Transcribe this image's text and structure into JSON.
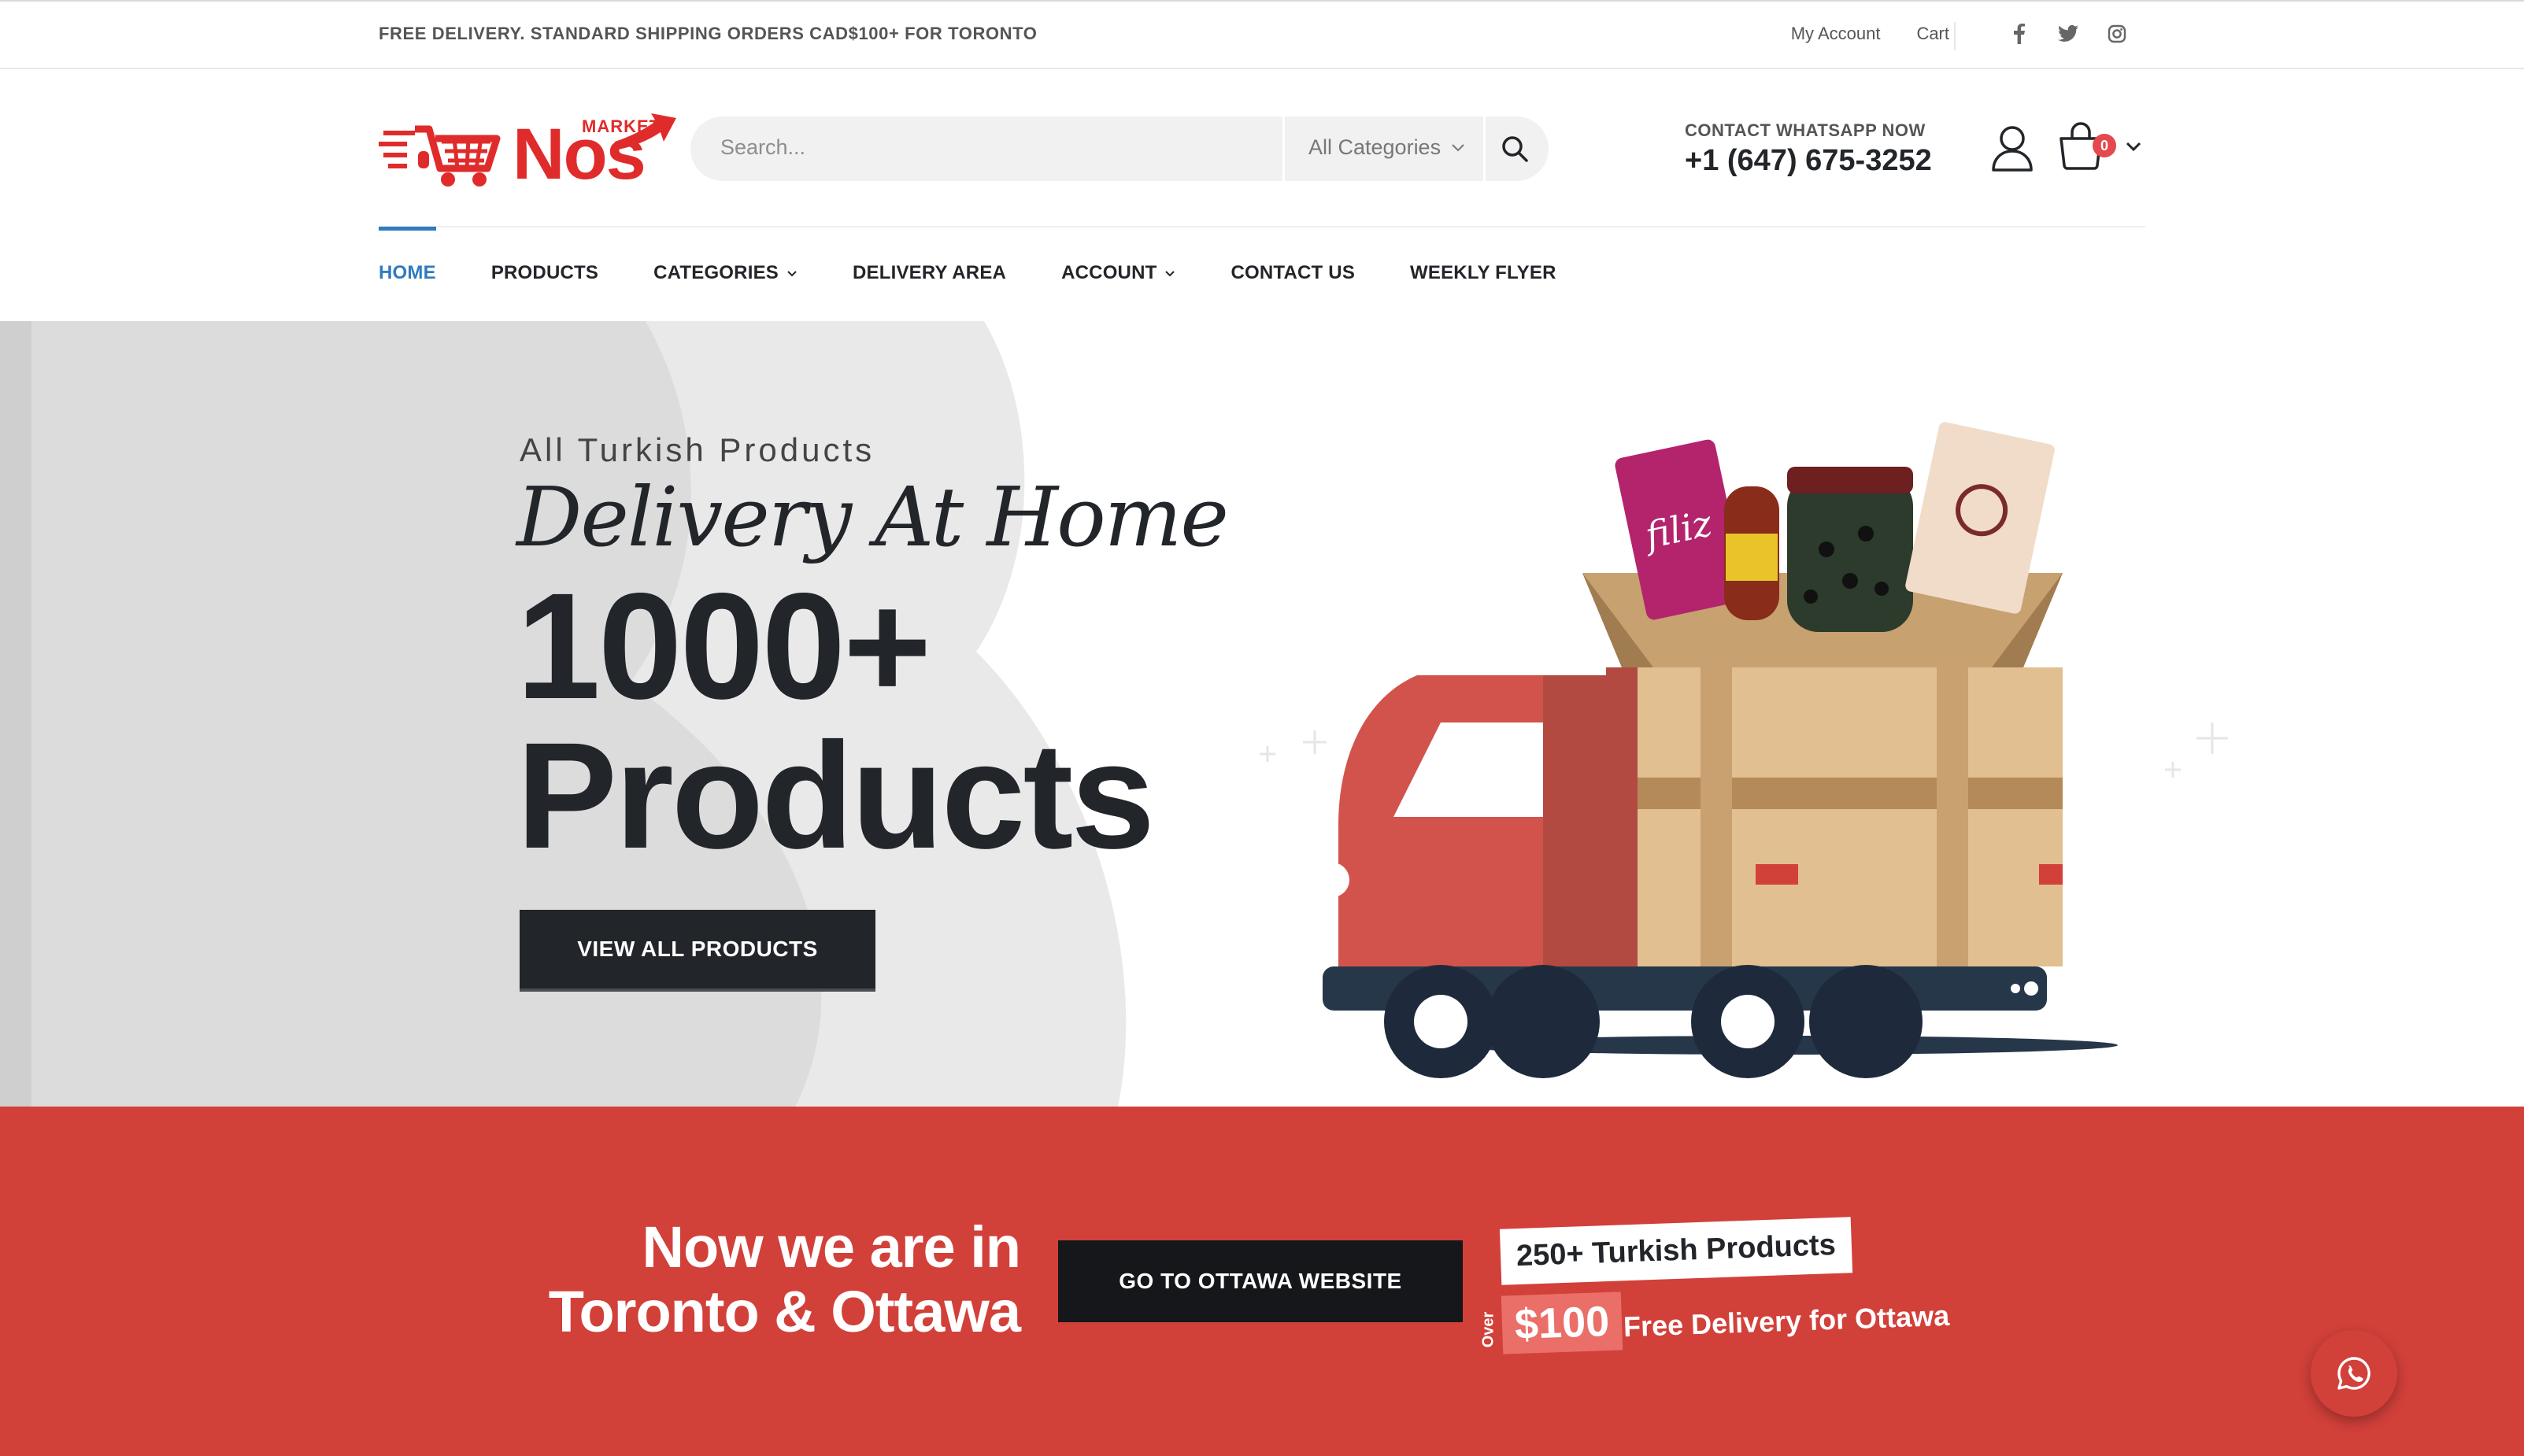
{
  "topbar": {
    "notice": "FREE DELIVERY. STANDARD SHIPPING ORDERS CAD$100+ FOR TORONTO",
    "links": [
      "My Account",
      "Cart"
    ],
    "social": [
      "facebook-icon",
      "twitter-icon",
      "instagram-icon"
    ]
  },
  "header": {
    "logo_market": "MARKET",
    "logo_brand": "Nos",
    "search_placeholder": "Search...",
    "category_select": "All Categories",
    "contact_label": "CONTACT WHATSAPP NOW",
    "contact_phone": "+1 (647) 675-3252",
    "cart_count": "0"
  },
  "nav": {
    "items": [
      "HOME",
      "PRODUCTS",
      "CATEGORIES",
      "DELIVERY AREA",
      "ACCOUNT",
      "CONTACT US",
      "WEEKLY FLYER"
    ],
    "active": "HOME"
  },
  "hero": {
    "subtitle": "All Turkish Products",
    "script": "Delivery At Home",
    "headline_line1": "1000+",
    "headline_line2": "Products",
    "cta": "VIEW ALL PRODUCTS"
  },
  "promo": {
    "headline_line1": "Now we are in",
    "headline_line2": "Toronto & Ottawa",
    "cta": "GO TO OTTAWA WEBSITE",
    "tag": "250+ Turkish Products",
    "over": "Over",
    "price": "$100",
    "free_text": "Free Delivery for Ottawa"
  },
  "colors": {
    "accent_blue": "#2f7bbf",
    "brand_red": "#e02b2b",
    "promo_red": "#d2403a",
    "dark": "#222529"
  }
}
